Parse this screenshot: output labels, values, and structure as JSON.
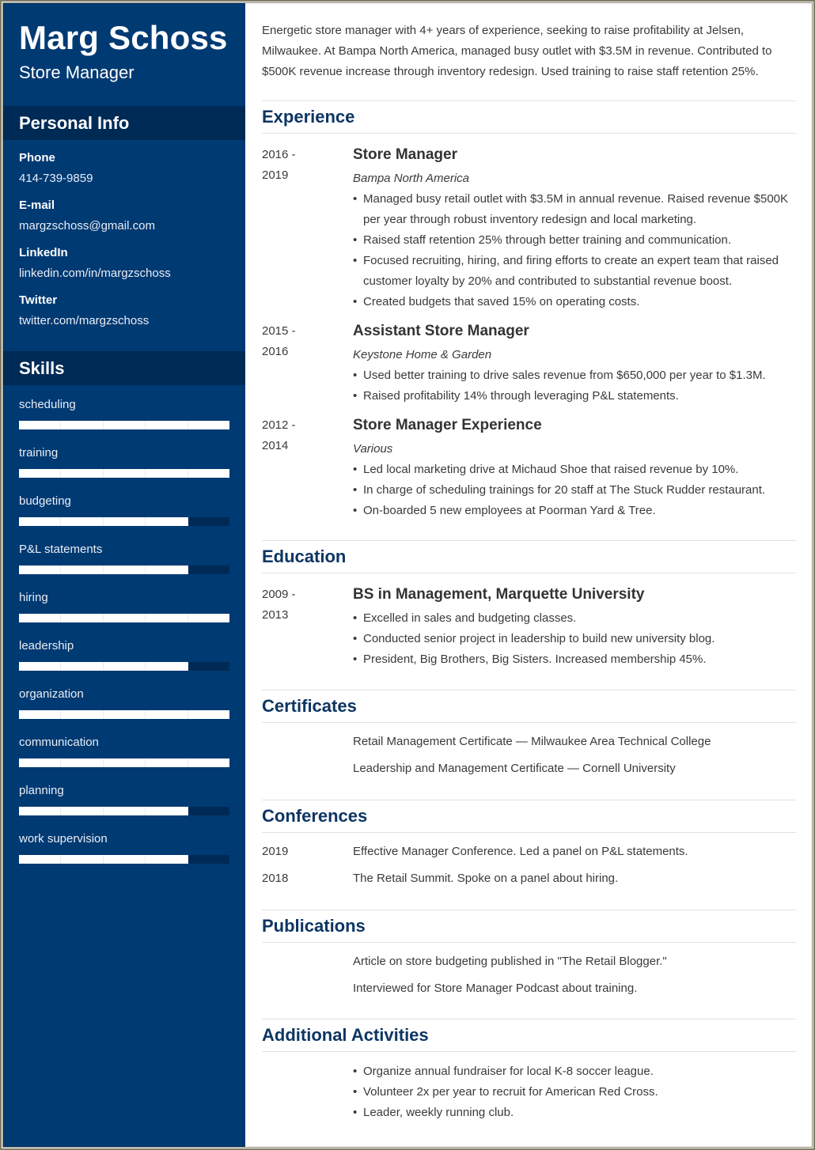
{
  "header": {
    "name": "Marg Schoss",
    "role": "Store Manager"
  },
  "theme": {
    "sidebar_color": "#003a73",
    "sidebar_header_color": "#002a56",
    "heading_color": "#0d3563",
    "border_color": "#7d7b66"
  },
  "personal_info": {
    "heading": "Personal Info",
    "items": [
      {
        "label": "Phone",
        "value": "414-739-9859"
      },
      {
        "label": "E-mail",
        "value": "margzschoss@gmail.com"
      },
      {
        "label": "LinkedIn",
        "value": "linkedin.com/in/margzschoss"
      },
      {
        "label": "Twitter",
        "value": "twitter.com/margzschoss"
      }
    ]
  },
  "skills": {
    "heading": "Skills",
    "max_level": 5,
    "items": [
      {
        "name": "scheduling",
        "level": 5
      },
      {
        "name": "training",
        "level": 5
      },
      {
        "name": "budgeting",
        "level": 4
      },
      {
        "name": "P&L statements",
        "level": 4
      },
      {
        "name": "hiring",
        "level": 5
      },
      {
        "name": "leadership",
        "level": 4
      },
      {
        "name": "organization",
        "level": 5
      },
      {
        "name": "communication",
        "level": 5
      },
      {
        "name": "planning",
        "level": 4
      },
      {
        "name": "work supervision",
        "level": 4
      }
    ]
  },
  "summary": "Energetic store manager with 4+ years of experience, seeking to raise profitability at Jelsen, Milwaukee. At Bampa North America, managed busy outlet with $3.5M in revenue. Contributed to $500K revenue increase through inventory redesign. Used training to raise staff retention 25%.",
  "experience": {
    "heading": "Experience",
    "entries": [
      {
        "date_start": "2016 -",
        "date_end": "2019",
        "title": "Store Manager",
        "company": "Bampa North America",
        "bullets": [
          "Managed busy retail outlet with $3.5M in annual revenue. Raised revenue $500K per year through robust inventory redesign and local marketing.",
          "Raised staff retention 25% through better training and communication.",
          "Focused recruiting, hiring, and firing efforts to create an expert team that raised customer loyalty by 20% and contributed to substantial revenue boost.",
          "Created budgets that saved 15% on operating costs."
        ]
      },
      {
        "date_start": "2015 -",
        "date_end": "2016",
        "title": "Assistant Store Manager",
        "company": "Keystone Home & Garden",
        "bullets": [
          "Used better training to drive sales revenue from $650,000 per year to $1.3M.",
          "Raised profitability 14% through leveraging P&L statements."
        ]
      },
      {
        "date_start": "2012 -",
        "date_end": "2014",
        "title": "Store Manager Experience",
        "company": "Various",
        "bullets": [
          "Led local marketing drive at Michaud Shoe that raised revenue by 10%.",
          "In charge of scheduling trainings for 20 staff at The Stuck Rudder restaurant.",
          "On-boarded 5 new employees at Poorman Yard & Tree."
        ]
      }
    ]
  },
  "education": {
    "heading": "Education",
    "entries": [
      {
        "date_start": "2009 -",
        "date_end": "2013",
        "title": "BS in Management, Marquette University",
        "bullets": [
          "Excelled in sales and budgeting classes.",
          "Conducted senior project in leadership to build new university blog.",
          "President, Big Brothers, Big Sisters. Increased membership 45%."
        ]
      }
    ]
  },
  "certificates": {
    "heading": "Certificates",
    "items": [
      "Retail Management Certificate — Milwaukee Area Technical College",
      "Leadership and Management Certificate — Cornell University"
    ]
  },
  "conferences": {
    "heading": "Conferences",
    "items": [
      {
        "year": "2019",
        "text": "Effective Manager Conference. Led a panel on P&L statements."
      },
      {
        "year": "2018",
        "text": "The Retail Summit. Spoke on a panel about hiring."
      }
    ]
  },
  "publications": {
    "heading": "Publications",
    "items": [
      "Article on store budgeting published in \"The Retail Blogger.\"",
      "Interviewed for Store Manager Podcast about training."
    ]
  },
  "activities": {
    "heading": "Additional Activities",
    "items": [
      "Organize annual fundraiser for local K-8 soccer league.",
      "Volunteer 2x per year to recruit for American Red Cross.",
      "Leader, weekly running club."
    ]
  }
}
